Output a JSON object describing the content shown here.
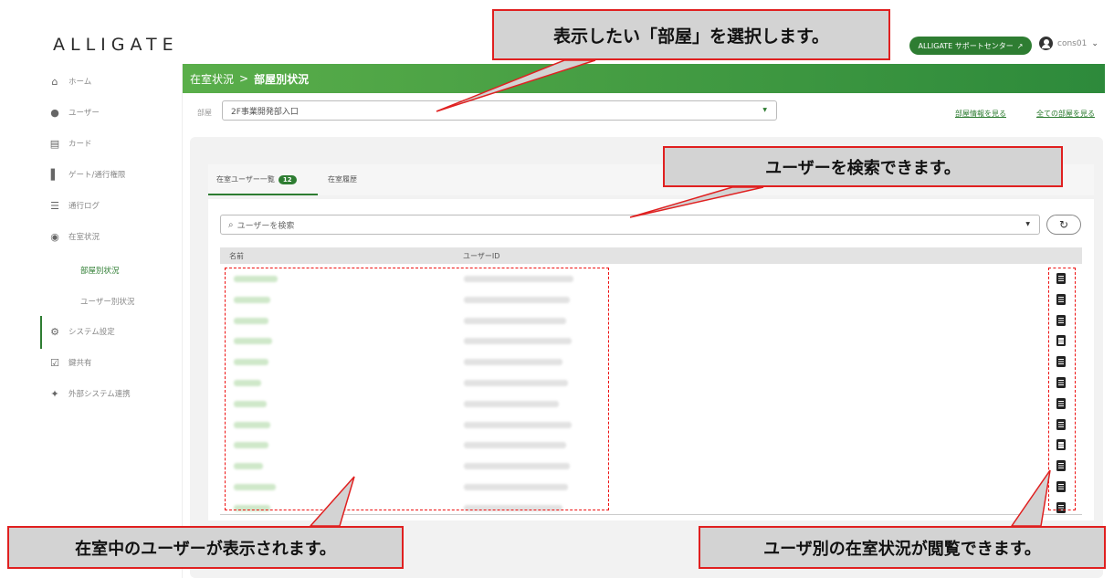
{
  "brand": {
    "logo": "ALLIGATE"
  },
  "topbar": {
    "support_label": "ALLIGATE サポートセンター",
    "user_name": "cons01"
  },
  "sidebar": {
    "items": [
      {
        "label": "ホーム",
        "icon": "home-icon"
      },
      {
        "label": "ユーザー",
        "icon": "user-icon"
      },
      {
        "label": "カード",
        "icon": "card-icon"
      },
      {
        "label": "ゲート/通行権限",
        "icon": "gate-icon"
      },
      {
        "label": "通行ログ",
        "icon": "list-icon"
      },
      {
        "label": "在室状況",
        "icon": "presence-icon"
      },
      {
        "label": "システム設定",
        "icon": "gear-icon"
      },
      {
        "label": "鍵共有",
        "icon": "checkbox-icon"
      },
      {
        "label": "外部システム連携",
        "icon": "puzzle-icon"
      }
    ],
    "sub_items": [
      {
        "label": "部屋別状況",
        "active": true
      },
      {
        "label": "ユーザー別状況",
        "active": false
      }
    ]
  },
  "breadcrumb": {
    "parent": "在室状況",
    "separator": ">",
    "current": "部屋別状況"
  },
  "room": {
    "label": "部屋",
    "selected": "2F事業開発部入口",
    "link_info": "部屋情報を見る",
    "link_all": "全ての部屋を見る"
  },
  "tabs": [
    {
      "label": "在室ユーザー一覧",
      "count": "12",
      "active": true
    },
    {
      "label": "在室履歴",
      "active": false
    }
  ],
  "search": {
    "placeholder": "ユーザーを検索"
  },
  "table": {
    "col_name": "名前",
    "col_userid": "ユーザーID",
    "row_count": 12
  },
  "callouts": {
    "room_select": "表示したい「部屋」を選択します。",
    "search": "ユーザーを検索できます。",
    "list": "在室中のユーザーが表示されます。",
    "detail": "ユーザ別の在室状況が閲覧できます。"
  },
  "colors": {
    "accent": "#2e7d32",
    "callout_border": "#e02020",
    "callout_bg": "#d3d3d3"
  }
}
